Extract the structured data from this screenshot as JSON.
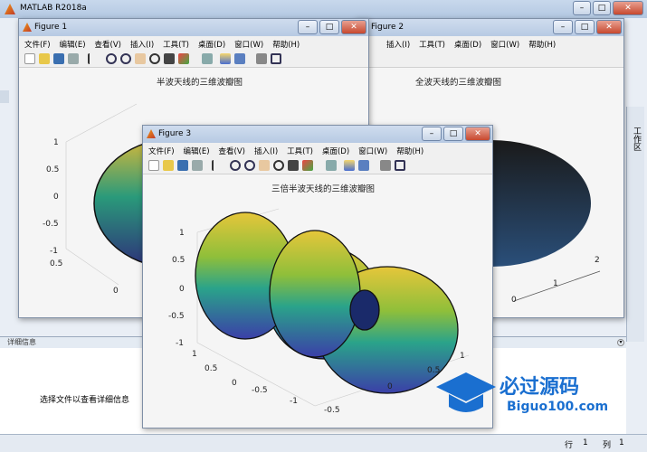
{
  "app": {
    "title": "MATLAB R2018a"
  },
  "right_panel": {
    "label": "工作区"
  },
  "detail": {
    "header": "详细信息",
    "text": "选择文件以查看详细信息"
  },
  "status": {
    "row_label": "行",
    "row_value": "1",
    "col_label": "列",
    "col_value": "1"
  },
  "menu": [
    "文件(F)",
    "编辑(E)",
    "查看(V)",
    "插入(I)",
    "工具(T)",
    "桌面(D)",
    "窗口(W)",
    "帮助(H)"
  ],
  "fig1": {
    "title": "Figure 1",
    "plot_title": "半波天线的三维波瓣图",
    "zticks": [
      "1",
      "0.5",
      "0",
      "-0.5",
      "-1"
    ],
    "yticks": [
      "0.5",
      "0"
    ]
  },
  "fig2": {
    "title": "Figure 2",
    "plot_title": "全波天线的三维波瓣图",
    "xticks": [
      "0",
      "1",
      "2"
    ]
  },
  "fig3": {
    "title": "Figure 3",
    "plot_title": "三倍半波天线的三维波瓣图",
    "zticks": [
      "1",
      "0.5",
      "0",
      "-0.5",
      "-1"
    ],
    "yticks": [
      "1",
      "0.5",
      "0",
      "-0.5",
      "-1"
    ],
    "xticks": [
      "1",
      "0.5",
      "0",
      "-0.5"
    ]
  },
  "watermark": {
    "brand": "必过源码",
    "url": "Biguo100.com"
  },
  "colors": {
    "surface_top": "#e2c43a",
    "surface_mid": "#2aa38a",
    "surface_low": "#3b3fa8",
    "titlebar": "#c4d4ea"
  }
}
